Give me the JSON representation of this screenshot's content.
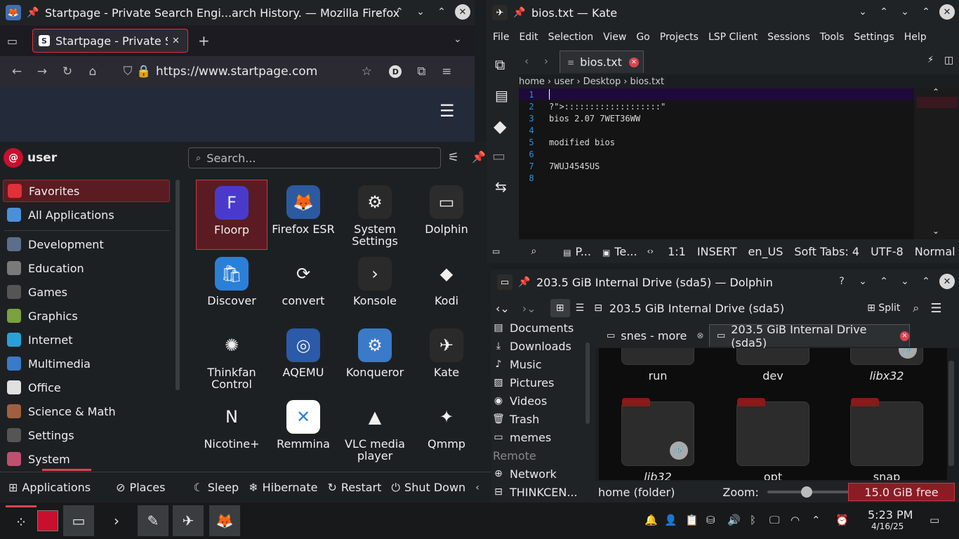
{
  "firefox": {
    "window_title": "Startpage - Private Search Engi...arch History. — Mozilla Firefox",
    "tab_label": "Startpage - Private Search Engine",
    "url": "https://www.startpage.com",
    "account_initial": "D"
  },
  "menu": {
    "user": "user",
    "search_placeholder": "Search...",
    "categories": [
      {
        "label": "Favorites",
        "color": "#e0303a"
      },
      {
        "label": "All Applications",
        "color": "#4a90d9"
      },
      {
        "label": "Development",
        "color": "#5b6e8c"
      },
      {
        "label": "Education",
        "color": "#7a7a7a"
      },
      {
        "label": "Games",
        "color": "#555555"
      },
      {
        "label": "Graphics",
        "color": "#7aa040"
      },
      {
        "label": "Internet",
        "color": "#2aa0d8"
      },
      {
        "label": "Multimedia",
        "color": "#3a7ac8"
      },
      {
        "label": "Office",
        "color": "#e0e0e0"
      },
      {
        "label": "Science & Math",
        "color": "#a06040"
      },
      {
        "label": "Settings",
        "color": "#555555"
      },
      {
        "label": "System",
        "color": "#c05070"
      }
    ],
    "apps": [
      {
        "label": "Floorp",
        "icon": "F",
        "color": "#4a3acc"
      },
      {
        "label": "Firefox ESR",
        "icon": "🦊",
        "color": "#2c5aa0"
      },
      {
        "label": "System Settings",
        "icon": "⚙",
        "color": "#2a2a2a"
      },
      {
        "label": "Dolphin",
        "icon": "▭",
        "color": "#2c2c2c"
      },
      {
        "label": "Discover",
        "icon": "🛍",
        "color": "#2a80d8"
      },
      {
        "label": "convert",
        "icon": "⟳",
        "color": "transparent"
      },
      {
        "label": "Konsole",
        "icon": "›",
        "color": "#2a2a2a"
      },
      {
        "label": "Kodi",
        "icon": "◆",
        "color": "transparent"
      },
      {
        "label": "Thinkfan Control",
        "icon": "✺",
        "color": "transparent"
      },
      {
        "label": "AQEMU",
        "icon": "◎",
        "color": "#2a5aa8"
      },
      {
        "label": "Konqueror",
        "icon": "⚙",
        "color": "#3a7ac8"
      },
      {
        "label": "Kate",
        "icon": "✈",
        "color": "#2a2a2a"
      },
      {
        "label": "Nicotine+",
        "icon": "N",
        "color": "transparent"
      },
      {
        "label": "Remmina",
        "icon": "✕",
        "color": "#ffffff"
      },
      {
        "label": "VLC media player",
        "icon": "▲",
        "color": "transparent"
      },
      {
        "label": "Qmmp",
        "icon": "✦",
        "color": "transparent"
      }
    ],
    "footer": {
      "applications": "Applications",
      "places": "Places",
      "sleep": "Sleep",
      "hibernate": "Hibernate",
      "restart": "Restart",
      "shutdown": "Shut Down"
    }
  },
  "kate": {
    "window_title": "bios.txt — Kate",
    "menu": [
      "File",
      "Edit",
      "Selection",
      "View",
      "Go",
      "Projects",
      "LSP Client",
      "Sessions",
      "Tools",
      "Settings",
      "Help"
    ],
    "tab_label": "bios.txt",
    "breadcrumbs": [
      "home",
      "user",
      "Desktop",
      "bios.txt"
    ],
    "lines": [
      {
        "n": "1",
        "text": ""
      },
      {
        "n": "2",
        "text": "?\">:::::::::::::::::::\""
      },
      {
        "n": "3",
        "text": "bios 2.07 7WET36WW"
      },
      {
        "n": "4",
        "text": ""
      },
      {
        "n": "5",
        "text": "modified bios"
      },
      {
        "n": "6",
        "text": ""
      },
      {
        "n": "7",
        "text": "7WUJ4545US"
      },
      {
        "n": "8",
        "text": ""
      }
    ],
    "status": {
      "p": "P...",
      "te": "Te...",
      "pos": "1:1",
      "mode": "INSERT",
      "lang": "en_US",
      "tabs": "Soft Tabs: 4",
      "enc": "UTF-8",
      "input": "Normal"
    }
  },
  "dolphin": {
    "window_title": "203.5 GiB Internal Drive (sda5) — Dolphin",
    "location": "203.5 GiB Internal Drive (sda5)",
    "split": "Split",
    "places": [
      "Documents",
      "Downloads",
      "Music",
      "Pictures",
      "Videos",
      "Trash",
      "memes"
    ],
    "remote_header": "Remote",
    "remote": [
      "Network",
      "THINKCEN..."
    ],
    "tabs": [
      "snes - more",
      "203.5 GiB Internal Drive (sda5)"
    ],
    "folders_row1": [
      "run",
      "dev",
      "libx32"
    ],
    "folders_row2": [
      "lib32",
      "opt",
      "snap"
    ],
    "status_left": "home (folder)",
    "zoom_label": "Zoom:",
    "free": "15.0 GiB free"
  },
  "clock": {
    "time": "5:23 PM",
    "date": "4/16/25"
  }
}
